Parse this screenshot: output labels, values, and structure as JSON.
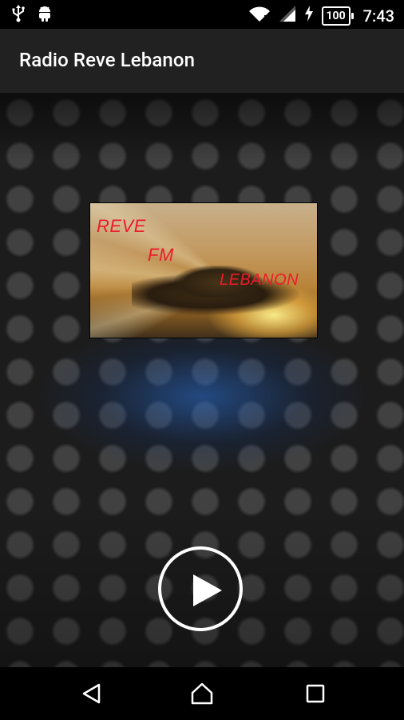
{
  "status_bar": {
    "battery": "100",
    "time": "7:43",
    "icons": [
      "usb-icon",
      "android-debug-icon",
      "wifi-icon",
      "signal-icon",
      "charging-icon",
      "battery-icon"
    ]
  },
  "app_bar": {
    "title": "Radio Reve Lebanon"
  },
  "station_logo": {
    "line1": "REVE",
    "line2": "FM",
    "line3": "LEBANON",
    "text_color": "#ee1a2a"
  },
  "player": {
    "play_icon": "play-icon"
  },
  "nav_bar": {
    "icons": [
      "back-icon",
      "home-icon",
      "recents-icon"
    ]
  },
  "colors": {
    "app_bar": "#212121",
    "status_bar": "#000000",
    "nav_bar": "#000000",
    "accent_glow": "#2e6ec8"
  }
}
